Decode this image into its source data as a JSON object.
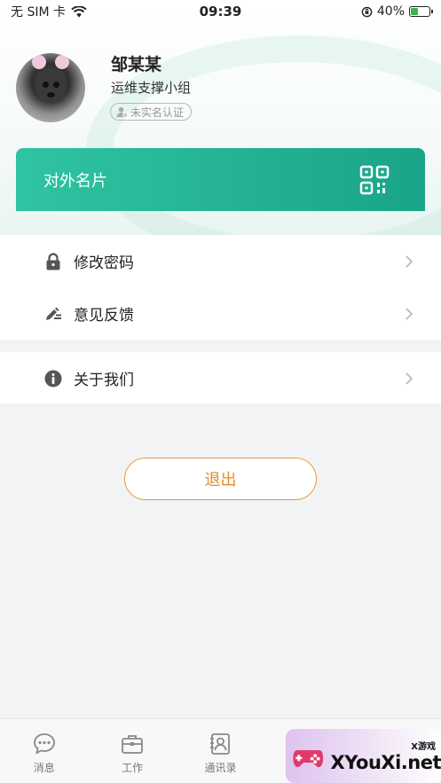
{
  "status_bar": {
    "carrier": "无 SIM 卡",
    "time": "09:39",
    "battery": "40%",
    "battery_level": 0.4
  },
  "profile": {
    "name": "邹某某",
    "group": "运维支撑小组",
    "verify_status": "未实名认证"
  },
  "card": {
    "title": "对外名片",
    "qr_icon": "qrcode-icon"
  },
  "menu_group_1": [
    {
      "label": "修改密码",
      "icon": "lock-icon"
    },
    {
      "label": "意见反馈",
      "icon": "edit-icon"
    }
  ],
  "menu_group_2": [
    {
      "label": "关于我们",
      "icon": "info-icon"
    }
  ],
  "logout": {
    "label": "退出"
  },
  "tabbar": {
    "tabs": [
      {
        "label": "消息",
        "icon": "chat-icon"
      },
      {
        "label": "工作",
        "icon": "briefcase-icon"
      },
      {
        "label": "通讯录",
        "icon": "contacts-icon"
      }
    ]
  },
  "watermark": {
    "small": "X游戏",
    "big": "XYouXi.net"
  },
  "colors": {
    "accent": "#1aa488",
    "logout": "#e0902a"
  }
}
